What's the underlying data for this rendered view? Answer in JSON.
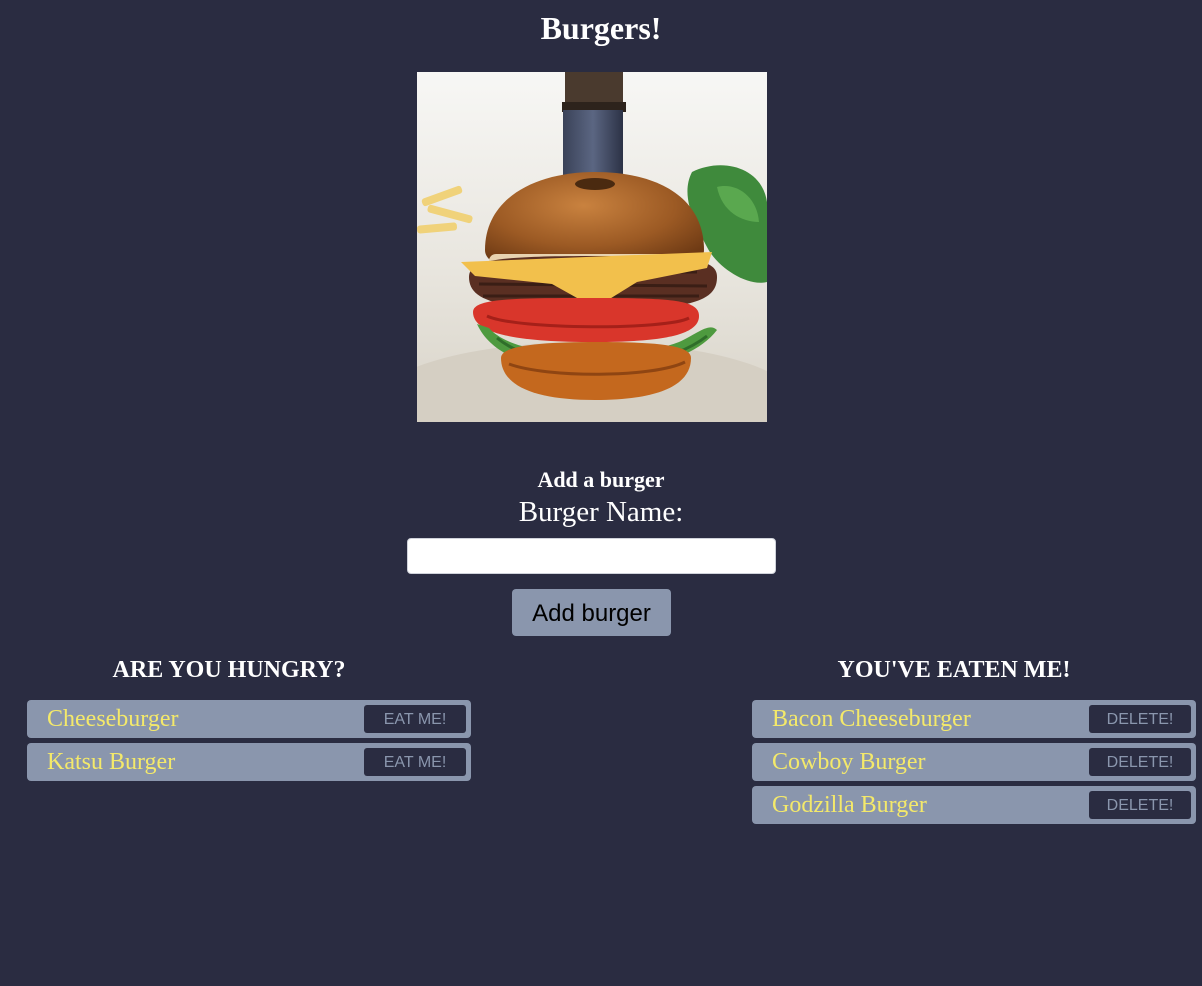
{
  "page": {
    "title": "Burgers!"
  },
  "hero_image": {
    "subject": "burger-photo"
  },
  "form": {
    "heading": "Add a burger",
    "label": "Burger Name:",
    "input_value": "",
    "submit_label": "Add burger"
  },
  "hungry": {
    "heading": "ARE YOU HUNGRY?",
    "items": [
      {
        "name": "Cheeseburger",
        "action": "EAT ME!"
      },
      {
        "name": "Katsu Burger",
        "action": "EAT ME!"
      }
    ]
  },
  "eaten": {
    "heading": "YOU'VE EATEN ME!",
    "items": [
      {
        "name": "Bacon Cheeseburger",
        "action": "DELETE!"
      },
      {
        "name": "Cowboy Burger",
        "action": "DELETE!"
      },
      {
        "name": "Godzilla Burger",
        "action": "DELETE!"
      }
    ]
  },
  "colors": {
    "background": "#2a2c41",
    "panel": "#8a96ad",
    "item_text": "#f4e96a"
  }
}
